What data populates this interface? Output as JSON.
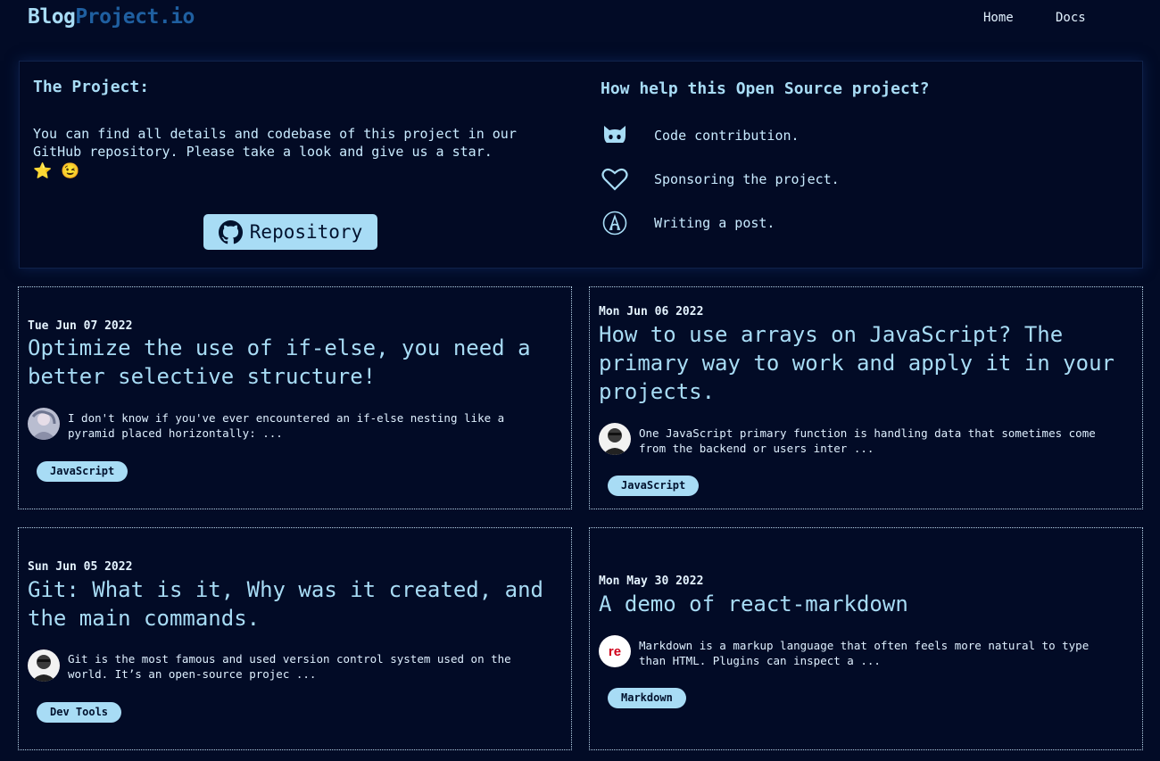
{
  "header": {
    "logo_part1": "Blog",
    "logo_part2": "Project.io",
    "nav": [
      {
        "label": "Home"
      },
      {
        "label": "Docs"
      }
    ]
  },
  "project": {
    "title": "The Project:",
    "description": "You can find all details and codebase of this project in our GitHub repository. Please take a look and give us a star.",
    "emojis": "⭐ 😉",
    "repo_button": "Repository",
    "help_title": "How help this Open Source project?",
    "help_items": [
      {
        "icon": "github-cat-icon",
        "label": "Code contribution."
      },
      {
        "icon": "heart-icon",
        "label": "Sponsoring the project."
      },
      {
        "icon": "pen-circle-icon",
        "label": "Writing a post."
      }
    ]
  },
  "posts": [
    {
      "date": "Tue Jun 07 2022",
      "title": "Optimize the use of if-else, you need a better selective structure!",
      "excerpt": "I don't know if you've ever encountered an if-else nesting like a pyramid placed horizontally: ...",
      "tag": "JavaScript"
    },
    {
      "date": "Mon Jun 06 2022",
      "title": "How to use arrays on JavaScript? The primary way to work and apply it in your projects.",
      "excerpt": "One JavaScript primary function is handling data that sometimes come from the backend or users inter ...",
      "tag": "JavaScript"
    },
    {
      "date": "Sun Jun 05 2022",
      "title": "Git: What is it, Why was it created, and the main commands.",
      "excerpt": "Git is the most famous and used version control system used on the world. It’s an open-source projec ...",
      "tag": "Dev Tools"
    },
    {
      "date": "Mon May 30 2022",
      "title": "A demo of react-markdown",
      "excerpt": "Markdown is a markup language that often feels more natural to type than HTML. Plugins can inspect a ...",
      "tag": "Markdown",
      "avatar_text": "re"
    }
  ],
  "colors": {
    "background": "#020b26",
    "accent": "#a8dcf5",
    "logo_secondary": "#1f5fa0"
  }
}
